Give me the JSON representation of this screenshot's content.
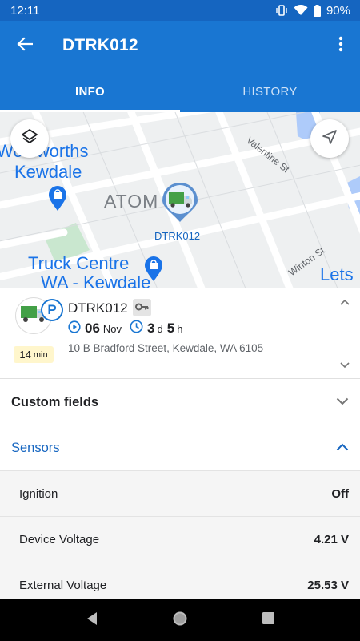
{
  "status_bar": {
    "time": "12:11",
    "battery": "90%"
  },
  "app_bar": {
    "title": "DTRK012"
  },
  "tabs": [
    {
      "label": "INFO",
      "active": true
    },
    {
      "label": "HISTORY",
      "active": false
    }
  ],
  "map": {
    "labels": {
      "place1_line1": "Woolworths",
      "place1_line2": "Kewdale",
      "place2": "ATOM",
      "place3_line1": "Truck Centre",
      "place3_line2": "WA - Kewdale",
      "street1": "Valentine St",
      "street2": "Winton St",
      "partial_right": "Lets"
    },
    "marker_label": "DTRK012",
    "icons": {
      "layers": "layers-icon",
      "locate": "navigation-icon"
    }
  },
  "device": {
    "name": "DTRK012",
    "status_letter": "P",
    "date_day": "06",
    "date_month": "Nov",
    "duration_days": "3",
    "duration_days_unit": "d",
    "duration_hours": "5",
    "duration_hours_unit": "h",
    "address": "10 B Bradford Street, Kewdale, WA 6105",
    "age_value": "14",
    "age_unit": "min"
  },
  "sections": {
    "custom_fields": "Custom fields",
    "sensors": "Sensors"
  },
  "sensors": [
    {
      "name": "Ignition",
      "value": "Off"
    },
    {
      "name": "Device Voltage",
      "value": "4.21 V"
    },
    {
      "name": "External Voltage",
      "value": "25.53 V"
    }
  ],
  "colors": {
    "primary": "#1976d2",
    "status_bar": "#1565c0",
    "accent_text": "#1565c0",
    "age_badge": "#fff6cc"
  }
}
